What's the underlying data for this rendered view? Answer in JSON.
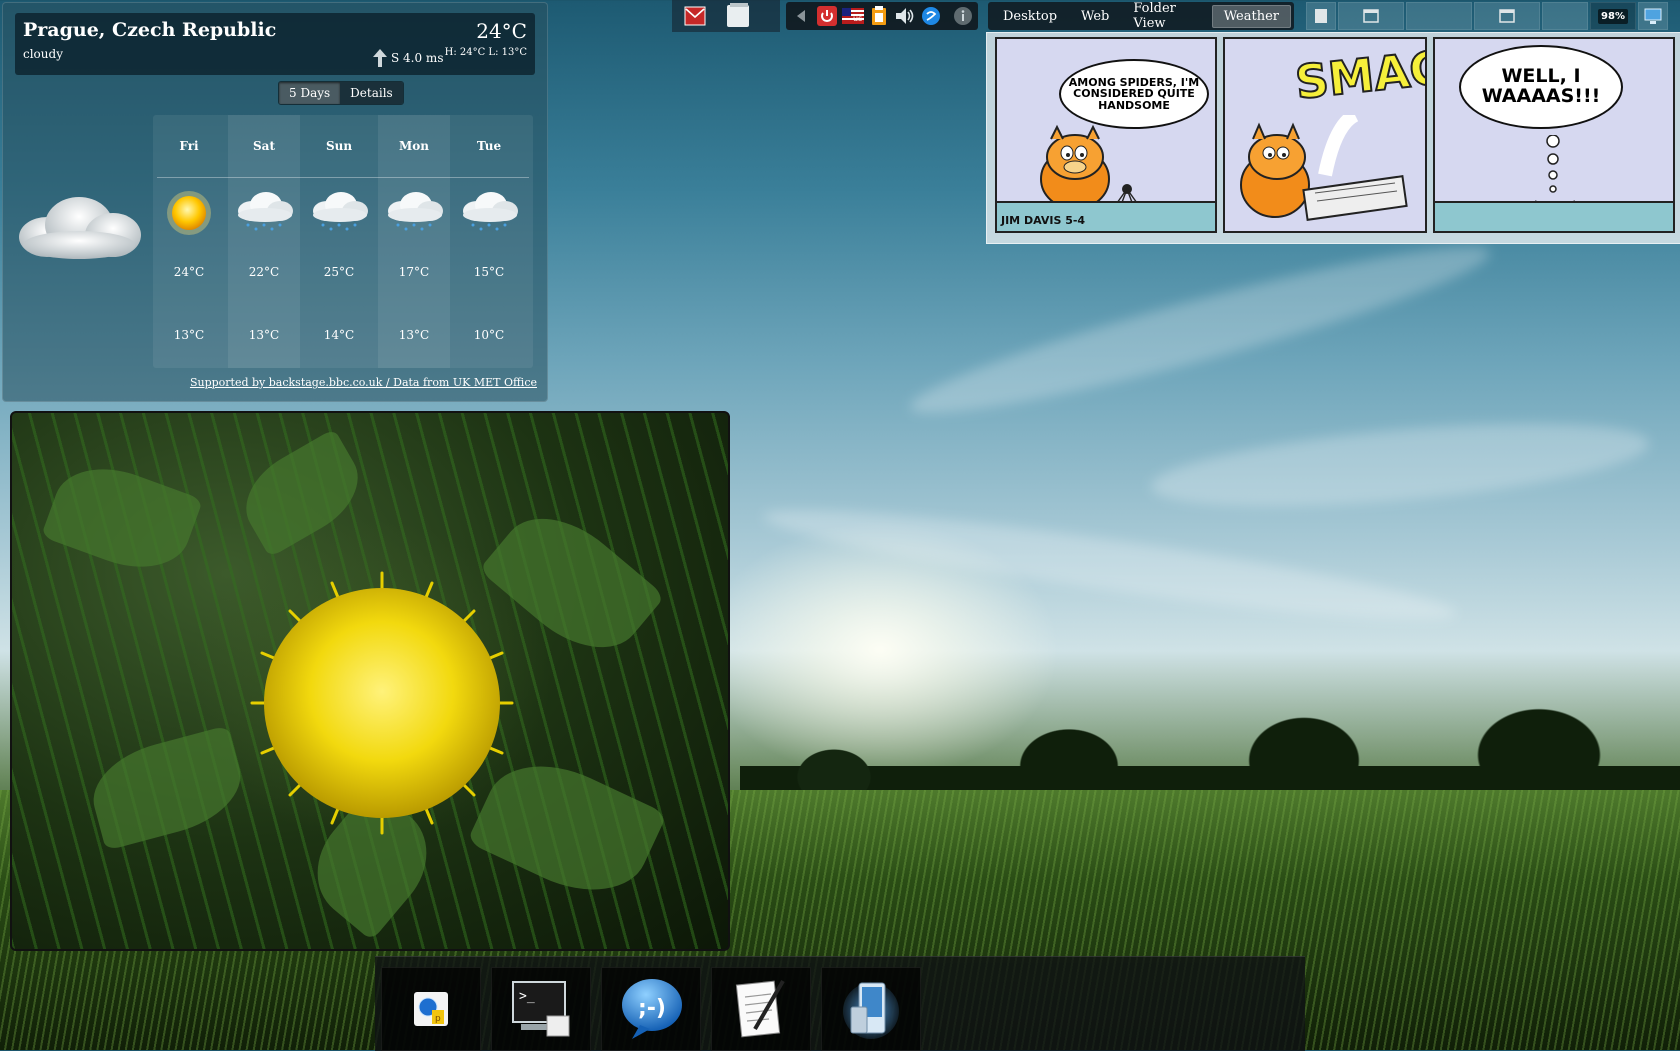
{
  "weather": {
    "city": "Prague, Czech Republic",
    "condition": "cloudy",
    "temperature": "24°C",
    "wind": "S 4.0 ms",
    "high_low": "H: 24°C L: 13°C",
    "tabs": [
      {
        "label": "5 Days",
        "active": true
      },
      {
        "label": "Details",
        "active": false
      }
    ],
    "forecast": [
      {
        "day": "Fri",
        "icon": "sun-icon",
        "high": "24°C",
        "low": "13°C"
      },
      {
        "day": "Sat",
        "icon": "rain-cloud-icon",
        "high": "22°C",
        "low": "13°C"
      },
      {
        "day": "Sun",
        "icon": "rain-cloud-icon",
        "high": "25°C",
        "low": "14°C"
      },
      {
        "day": "Mon",
        "icon": "rain-cloud-icon",
        "high": "17°C",
        "low": "13°C"
      },
      {
        "day": "Tue",
        "icon": "rain-cloud-icon",
        "high": "15°C",
        "low": "10°C"
      }
    ],
    "credit": "Supported by backstage.bbc.co.uk / Data from UK MET Office"
  },
  "panel": {
    "activities": [
      {
        "label": "Desktop",
        "active": false
      },
      {
        "label": "Web",
        "active": false
      },
      {
        "label": "Folder View",
        "active": false
      },
      {
        "label": "Weather",
        "active": true
      }
    ],
    "tray_icons": [
      "arrow-left-icon",
      "power-icon",
      "keyboard-layout-icon",
      "clipboard-icon",
      "volume-icon",
      "network-icon",
      "info-icon"
    ],
    "keyboard_layout": "us",
    "battery": "98%"
  },
  "comic": {
    "bubble1": "AMONG SPIDERS, I'M CONSIDERED QUITE HANDSOME",
    "sound": "SMACK!",
    "bubble3": "WELL, I WAAAAS!!!",
    "signature": "JIM DAVIS 5-4"
  },
  "dock": {
    "items": [
      "web-browser-icon",
      "terminal-icon",
      "chat-icon",
      "text-editor-icon",
      "device-icon"
    ]
  },
  "colors": {
    "accent_tab": "#7a8286",
    "comic_bg": "#d6d8f0",
    "comic_floor": "#8ec7cf",
    "smack": "#f6ef3a"
  }
}
